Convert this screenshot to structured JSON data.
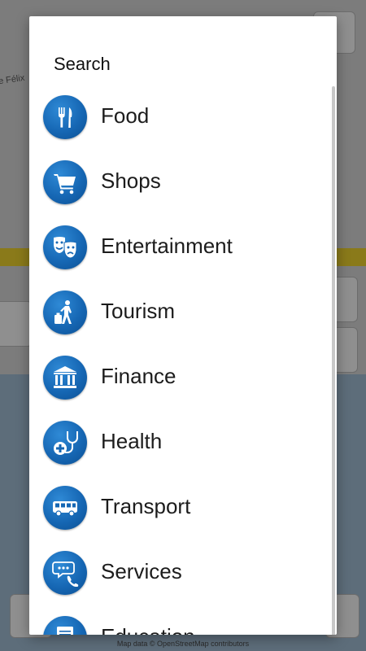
{
  "map": {
    "street_label": "e Félix",
    "attribution": "Map data © OpenStreetMap contributors"
  },
  "dialog": {
    "title": "Search",
    "categories": [
      {
        "label": "Food",
        "icon": "fork-knife-icon"
      },
      {
        "label": "Shops",
        "icon": "shopping-cart-icon"
      },
      {
        "label": "Entertainment",
        "icon": "theater-masks-icon"
      },
      {
        "label": "Tourism",
        "icon": "traveler-luggage-icon"
      },
      {
        "label": "Finance",
        "icon": "bank-icon"
      },
      {
        "label": "Health",
        "icon": "stethoscope-icon"
      },
      {
        "label": "Transport",
        "icon": "bus-icon"
      },
      {
        "label": "Services",
        "icon": "phone-chat-icon"
      },
      {
        "label": "Education",
        "icon": "diploma-icon"
      }
    ]
  },
  "colors": {
    "icon_blue": "#1667b4",
    "overlay_dim": "#808080"
  }
}
